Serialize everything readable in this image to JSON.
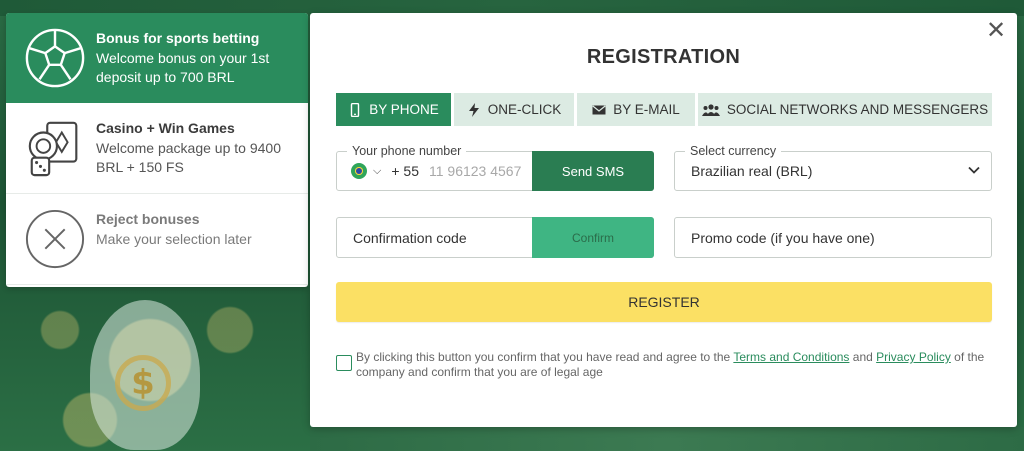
{
  "bonuses": [
    {
      "title": "Bonus for sports betting",
      "desc": "Welcome bonus on your 1st deposit up to 700 BRL",
      "icon": "soccer-ball-icon",
      "active": true
    },
    {
      "title": "Casino + Win Games",
      "desc": "Welcome package up to 9400 BRL + 150 FS",
      "icon": "casino-chips-cards-icon",
      "active": false
    },
    {
      "title": "Reject bonuses",
      "desc": "Make your selection later",
      "icon": "reject-x-icon",
      "active": false
    }
  ],
  "modal": {
    "close_icon": "close-icon",
    "title": "REGISTRATION",
    "tabs": [
      {
        "label": "BY PHONE",
        "icon": "phone-icon",
        "active": true
      },
      {
        "label": "ONE-CLICK",
        "icon": "lightning-icon",
        "active": false
      },
      {
        "label": "BY E-MAIL",
        "icon": "envelope-icon",
        "active": false
      },
      {
        "label": "SOCIAL NETWORKS AND MESSENGERS",
        "icon": "users-icon",
        "active": false
      }
    ],
    "phone": {
      "label": "Your phone number",
      "country_code": "+ 55",
      "placeholder": "11 96123 4567",
      "send_sms": "Send SMS"
    },
    "currency": {
      "label": "Select currency",
      "value": "Brazilian real (BRL)"
    },
    "confirmation": {
      "placeholder": "Confirmation code",
      "button": "Confirm"
    },
    "promo": {
      "placeholder": "Promo code (if you have one)"
    },
    "register": "REGISTER",
    "terms": {
      "prefix": "By clicking this button you confirm that you have read and agree to the",
      "terms_link": "Terms and Conditions",
      "and": "and",
      "privacy_link": "Privacy Policy",
      "suffix": "of the company and confirm that you are of legal age"
    }
  },
  "colors": {
    "brand_green": "#2a8c5d",
    "register_yellow": "#fbe064",
    "tab_inactive": "#dcebe3"
  }
}
